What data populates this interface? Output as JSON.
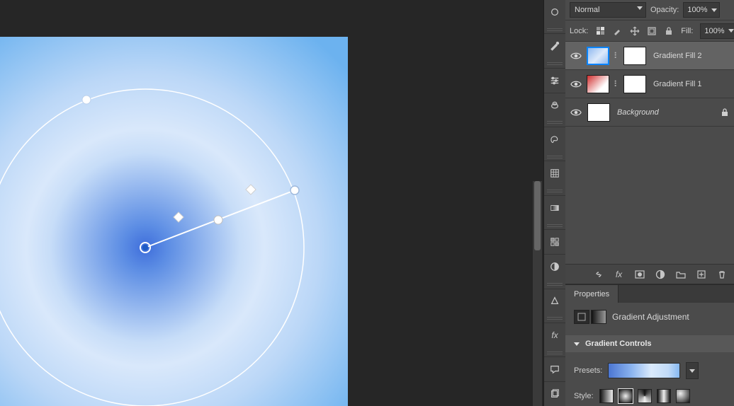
{
  "layersPanel": {
    "blendMode": "Normal",
    "opacityLabel": "Opacity:",
    "opacityValue": "100%",
    "lockLabel": "Lock:",
    "fillLabel": "Fill:",
    "fillValue": "100%",
    "layers": [
      {
        "name": "Gradient Fill 2",
        "kind": "gradient-blue",
        "visible": true,
        "active": true,
        "masked": true,
        "italic": false
      },
      {
        "name": "Gradient Fill 1",
        "kind": "gradient-red",
        "visible": true,
        "active": false,
        "masked": true,
        "italic": false
      },
      {
        "name": "Background",
        "kind": "white",
        "visible": true,
        "active": false,
        "masked": false,
        "italic": true,
        "locked": true
      }
    ]
  },
  "propertiesPanel": {
    "tab": "Properties",
    "adjustmentTitle": "Gradient Adjustment",
    "section": "Gradient Controls",
    "presetsLabel": "Presets:",
    "styleLabel": "Style:"
  },
  "toolbar": {
    "items": [
      "brush",
      "mixer-brush",
      "tool-options",
      "clone",
      "history-brush",
      "swatches",
      "grid",
      "gradient",
      "pattern",
      "adjustment",
      "shape",
      "fx",
      "note",
      "artboard"
    ]
  }
}
